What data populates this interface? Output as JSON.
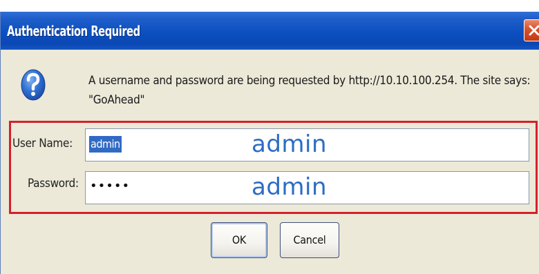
{
  "dialog": {
    "title": "Authentication Required",
    "message_line1": "A username and password are being requested by http://10.10.100.254. The site says:",
    "message_line2": "\"GoAhead\""
  },
  "fields": {
    "username_label": "User Name:",
    "username_value": "admin",
    "password_label": "Password:",
    "password_masked": "•••••"
  },
  "annotations": {
    "username_hint": "admin",
    "password_hint": "admin"
  },
  "buttons": {
    "ok_label": "OK",
    "cancel_label": "Cancel"
  },
  "icons": {
    "help": "question-mark-icon",
    "close": "close-icon"
  },
  "colors": {
    "titlebar": "#0c4fc0",
    "highlight_border": "#d61f2c",
    "annotation_text": "#2b6cc4",
    "selection": "#316ac5"
  }
}
